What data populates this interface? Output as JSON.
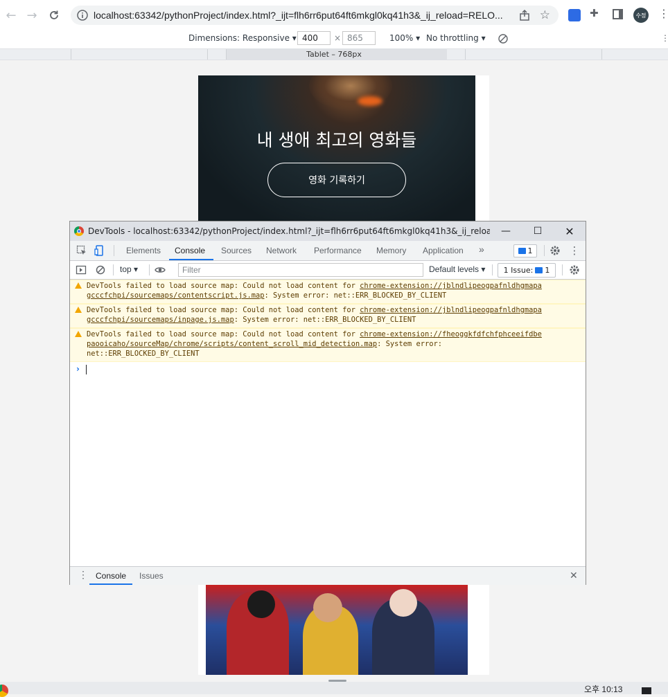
{
  "browser": {
    "url": "localhost:63342/pythonProject/index.html?_ijt=flh6rr6put64ft6mkgl0kq41h3&_ij_reload=RELO...",
    "avatar_text": "수정",
    "icons": [
      "back-icon",
      "forward-icon",
      "reload-icon",
      "info-icon",
      "share-icon",
      "star-icon",
      "extension-icon",
      "puzzle-icon",
      "sidepanel-icon",
      "kebab-icon"
    ]
  },
  "device_toolbar": {
    "dimensions_label": "Dimensions: Responsive",
    "width": "400",
    "times": "×",
    "height": "865",
    "zoom": "100%",
    "throttle": "No throttling",
    "media_label": "Tablet – 768px"
  },
  "page": {
    "hero_title": "내 생애 최고의 영화들",
    "hero_button": "영화 기록하기"
  },
  "devtools": {
    "title": "DevTools - localhost:63342/pythonProject/index.html?_ijt=flh6rr6put64ft6mkgl0kq41h3&_ij_reload=RELO...",
    "tabs": [
      "Elements",
      "Console",
      "Sources",
      "Network",
      "Performance",
      "Memory",
      "Application"
    ],
    "more_tabs": "»",
    "issues_count": "1",
    "filter_bar": {
      "context": "top",
      "filter_placeholder": "Filter",
      "levels": "Default levels",
      "issues_label": "1 Issue:",
      "issues_count": "1"
    },
    "messages": [
      {
        "line1_prefix": "DevTools failed to load source map: Could not load content for ",
        "link_part1": "chrome-extension://jblndlipeogpafnldhgmapa",
        "link_part2": "gcccfchpi/sourcemaps/contentscript.js.map",
        "line2_suffix": ": System error: net::ERR_BLOCKED_BY_CLIENT"
      },
      {
        "line1_prefix": "DevTools failed to load source map: Could not load content for ",
        "link_part1": "chrome-extension://jblndlipeogpafnldhgmapa",
        "link_part2": "gcccfchpi/sourcemaps/inpage.js.map",
        "line2_suffix": ": System error: net::ERR_BLOCKED_BY_CLIENT"
      },
      {
        "line1_prefix": "DevTools failed to load source map: Could not load content for ",
        "link_part1": "chrome-extension://fheoggkfdfchfphceeifdbe",
        "link_part2": "paooicaho/sourceMap/chrome/scripts/content_scroll_mid_detection.map",
        "line2_suffix": ": System error:",
        "line3": "net::ERR_BLOCKED_BY_CLIENT"
      }
    ],
    "drawer_tabs": [
      "Console",
      "Issues"
    ]
  },
  "taskbar": {
    "time": "오후 10:13"
  }
}
